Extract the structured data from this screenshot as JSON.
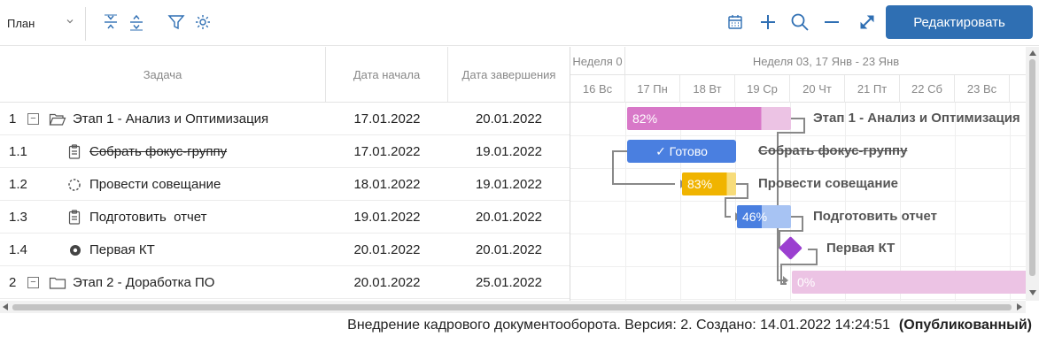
{
  "toolbar": {
    "view_select": "План",
    "edit_button": "Редактировать",
    "colors": {
      "icon": "#2f6fb3",
      "button_bg": "#2f6fb3"
    },
    "icons_left": [
      "collapse-all-icon",
      "expand-all-icon",
      "filter-icon",
      "settings-icon"
    ],
    "icons_right": [
      "calendar-icon",
      "zoom-plus-icon",
      "search-icon",
      "zoom-minus-icon",
      "fullscreen-icon"
    ]
  },
  "grid": {
    "columns": [
      "Задача",
      "Дата начала",
      "Дата завершения"
    ],
    "rows": [
      {
        "num": "1",
        "name": "Этап 1 - Анализ и Оптимизация",
        "start": "17.01.2022",
        "end": "20.01.2022",
        "icon": "folder-open-icon",
        "toggle": "−"
      },
      {
        "num": "1.1",
        "name": "Собрать фокус-группу",
        "start": "17.01.2022",
        "end": "19.01.2022",
        "icon": "clipboard-icon",
        "done": true
      },
      {
        "num": "1.2",
        "name": "Провести совещание",
        "start": "18.01.2022",
        "end": "19.01.2022",
        "icon": "dashed-circle-icon"
      },
      {
        "num": "1.3",
        "name": "Подготовить  отчет",
        "start": "19.01.2022",
        "end": "20.01.2022",
        "icon": "clipboard-icon"
      },
      {
        "num": "1.4",
        "name": "Первая КТ",
        "start": "20.01.2022",
        "end": "20.01.2022",
        "icon": "milestone-dot-icon"
      },
      {
        "num": "2",
        "name": "Этап 2 - Доработка ПО",
        "start": "20.01.2022",
        "end": "25.01.2022",
        "icon": "folder-icon",
        "toggle": "−"
      }
    ]
  },
  "chart": {
    "week_prev": "Неделя 0",
    "week_current": "Неделя 03, 17 Янв - 23 Янв",
    "days": [
      "16 Вс",
      "17 Пн",
      "18 Вт",
      "19 Ср",
      "20 Чт",
      "21 Пт",
      "22 Сб",
      "23 Вс"
    ],
    "bars": [
      {
        "row": 0,
        "label": "82%",
        "progress": 0.82,
        "color": "#d878c8",
        "bg": "#ecc3e4",
        "title": "Этап 1 - Анализ и Оптимизация"
      },
      {
        "row": 1,
        "label": "✓ Готово",
        "progress": 1.0,
        "color": "#4a7fe0",
        "bg": "#4a7fe0",
        "title": "Собрать фокус-группу",
        "strike": true
      },
      {
        "row": 2,
        "label": "83%",
        "progress": 0.83,
        "color": "#f0b400",
        "bg": "#f7dc7a",
        "title": "Провести совещание"
      },
      {
        "row": 3,
        "label": "46%",
        "progress": 0.46,
        "color": "#4a7fe0",
        "bg": "#a7c3f3",
        "title": "Подготовить отчет"
      },
      {
        "row": 4,
        "label": "",
        "milestone": true,
        "color": "#9b3fd0",
        "title": "Первая КТ"
      },
      {
        "row": 5,
        "label": "0%",
        "progress": 0.0,
        "color": "#ecc3e4",
        "bg": "#ecc3e4",
        "title": ""
      }
    ]
  },
  "status": {
    "text": "Внедрение кадрового документооборота. Версия: 2. Создано: 14.01.2022 14:24:51",
    "state": "(Опубликованный)"
  }
}
